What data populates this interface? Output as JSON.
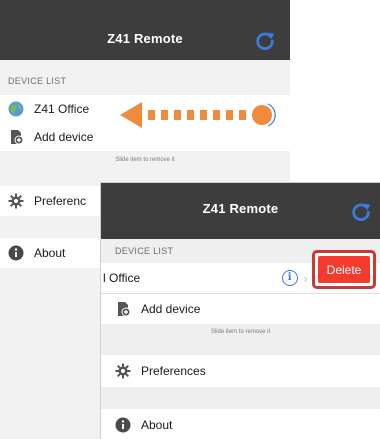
{
  "app": {
    "title": "Z41 Remote"
  },
  "list": {
    "section_header": "DEVICE LIST",
    "device_name": "Z41 Office",
    "device_name_truncated": "l Office",
    "add_device": "Add device",
    "hint": "Slide item to remove it",
    "preferences": "Preferences",
    "preferences_truncated": "Preferenc",
    "about": "About"
  },
  "actions": {
    "delete": "Delete",
    "info_glyph": "i",
    "chevron": "›"
  },
  "icons": {
    "refresh": "refresh-icon",
    "device": "globe-icon",
    "add": "add-device-icon",
    "preferences": "gear-icon",
    "about": "info-icon"
  },
  "colors": {
    "navbar": "#3d3d3d",
    "accent_blue": "#3a7be0",
    "swipe_orange": "#f08a3c",
    "delete_red": "#f33b2f",
    "highlight_red": "#c63b34"
  }
}
